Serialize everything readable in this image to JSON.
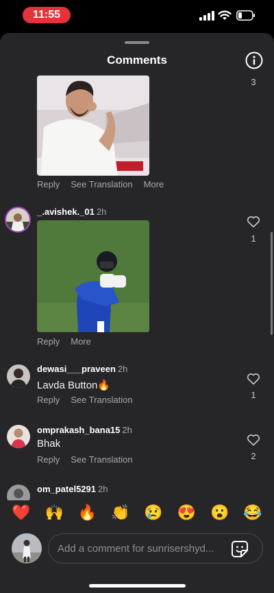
{
  "status_bar": {
    "time": "11:55"
  },
  "sheet": {
    "title": "Comments"
  },
  "comments": [
    {
      "likes": "3",
      "actions": [
        "Reply",
        "See Translation",
        "More"
      ]
    },
    {
      "username": "_.avishek._01",
      "time": "2h",
      "likes": "1",
      "actions": [
        "Reply",
        "More"
      ]
    },
    {
      "username": "dewasi___praveen",
      "time": "2h",
      "text": "Lavda Button🔥",
      "likes": "1",
      "actions": [
        "Reply",
        "See Translation"
      ]
    },
    {
      "username": "omprakash_bana15",
      "time": "2h",
      "text": "Bhak",
      "likes": "2",
      "actions": [
        "Reply",
        "See Translation"
      ]
    },
    {
      "username": "om_patel5291",
      "time": "2h"
    }
  ],
  "emoji_reactions": [
    "❤️",
    "🙌",
    "🔥",
    "👏",
    "😢",
    "😍",
    "😮",
    "😂"
  ],
  "composer": {
    "placeholder": "Add a comment for sunrisershyd..."
  },
  "icons": [
    "info-icon",
    "heart-icon",
    "sticker-icon",
    "signal-icon",
    "wifi-icon",
    "battery-icon"
  ]
}
